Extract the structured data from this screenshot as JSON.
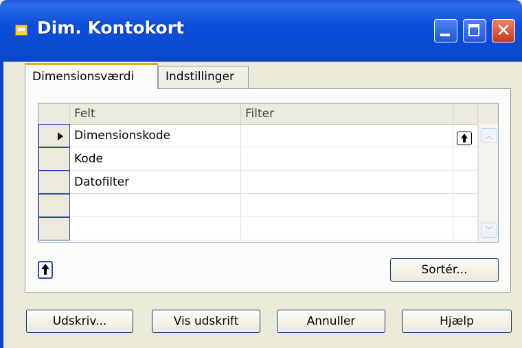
{
  "window": {
    "title": "Dim. Kontokort",
    "controls": [
      "minimize-icon",
      "maximize-icon",
      "close-icon"
    ],
    "close_glyph": "✕"
  },
  "tabs": [
    {
      "label": "Dimensionsværdi",
      "active": true
    },
    {
      "label": "Indstillinger",
      "active": false
    }
  ],
  "grid": {
    "columns": [
      "Felt",
      "Filter"
    ],
    "rows": [
      {
        "felt": "Dimensionskode",
        "filter": "",
        "current": true
      },
      {
        "felt": "Kode",
        "filter": "",
        "current": false
      },
      {
        "felt": "Datofilter",
        "filter": "",
        "current": false
      },
      {
        "felt": "",
        "filter": "",
        "current": false
      },
      {
        "felt": "",
        "filter": "",
        "current": false
      }
    ]
  },
  "buttons": {
    "sort": "Sortér...",
    "print": "Udskriv...",
    "preview": "Vis udskrift",
    "cancel": "Annuller",
    "help": "Hjælp"
  },
  "colors": {
    "titlebar": "#0b4bd3",
    "dialog_bg": "#ece9d8",
    "tab_accent": "#f0a72d",
    "close_button": "#c63b1c"
  }
}
